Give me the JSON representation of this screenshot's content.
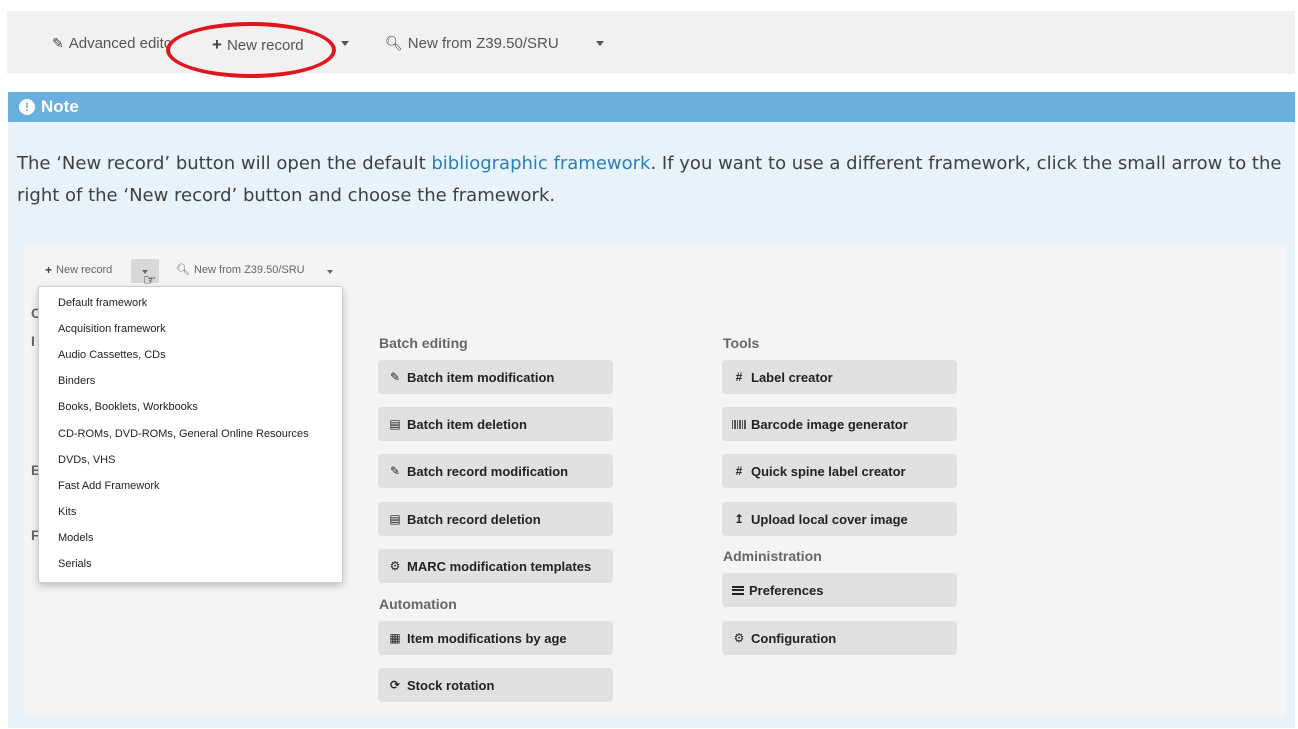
{
  "toolbar": {
    "advanced_editor": "Advanced edito",
    "new_record": "New record",
    "new_from_z3950": "New from Z39.50/SRU"
  },
  "note": {
    "title": "Note",
    "text_before": "The ‘New record’ button will open the default ",
    "link_text": "bibliographic framework",
    "text_after": ". If you want to use a different framework, click the small arrow to the right of the ‘New record’ button and choose the framework."
  },
  "inner": {
    "toolbar": {
      "new_record": "New record",
      "new_from_z3950": "New from Z39.50/SRU"
    },
    "dropdown_items": [
      "Default framework",
      "Acquisition framework",
      "Audio Cassettes, CDs",
      "Binders",
      "Books, Booklets, Workbooks",
      "CD-ROMs, DVD-ROMs, General Online Resources",
      "DVDs, VHS",
      "Fast Add Framework",
      "Kits",
      "Models",
      "Serials"
    ],
    "batch_editing": {
      "heading": "Batch editing",
      "buttons": [
        "Batch item modification",
        "Batch item deletion",
        "Batch record modification",
        "Batch record deletion",
        "MARC modification templates"
      ]
    },
    "automation": {
      "heading": "Automation",
      "buttons": [
        "Item modifications by age",
        "Stock rotation"
      ]
    },
    "tools": {
      "heading": "Tools",
      "buttons": [
        "Label creator",
        "Barcode image generator",
        "Quick spine label creator",
        "Upload local cover image"
      ]
    },
    "administration": {
      "heading": "Administration",
      "buttons": [
        "Preferences",
        "Configuration"
      ]
    },
    "stub_letters": [
      "C",
      "I",
      "E",
      "F"
    ]
  },
  "colors": {
    "note_header": "#6ab0de",
    "note_body": "#e7f2fa",
    "link": "#2980b9",
    "highlight": "#e0161f"
  }
}
